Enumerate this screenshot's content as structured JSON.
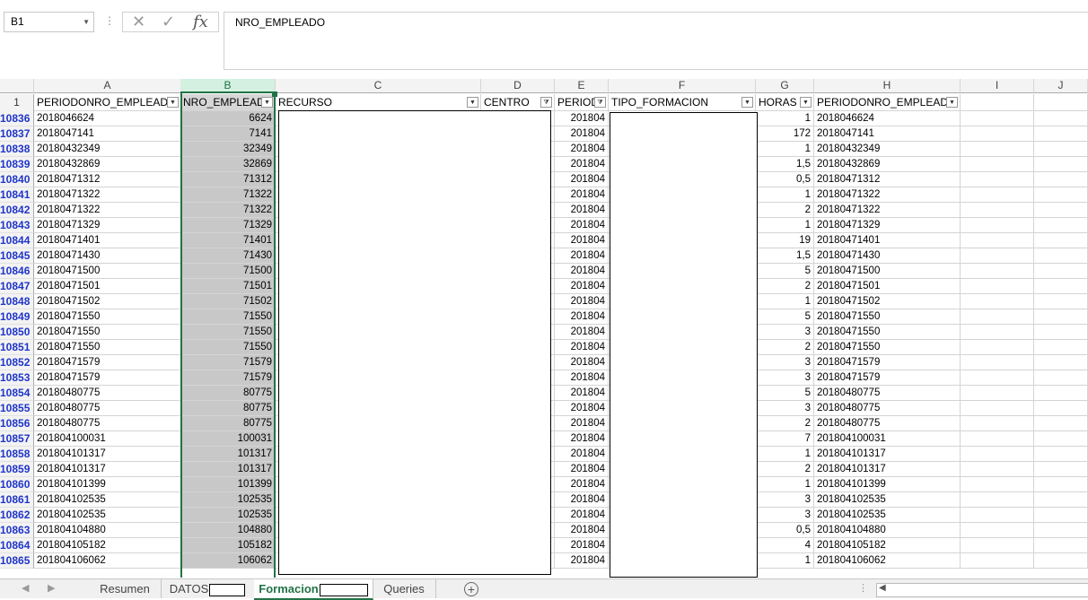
{
  "formula_bar": {
    "name_box": "B1",
    "content": "NRO_EMPLEADO",
    "fx": "fx",
    "cancel": "✕",
    "enter": "✓"
  },
  "columns": [
    "A",
    "B",
    "C",
    "D",
    "E",
    "F",
    "G",
    "H",
    "I",
    "J"
  ],
  "header_row": {
    "number": "1",
    "A": "PERIODONRO_EMPLEADO",
    "B": "NRO_EMPLEADO",
    "C": "RECURSO",
    "D": "CENTRO",
    "E": "PERIOD",
    "F": "TIPO_FORMACION",
    "G": "HORAS",
    "H": "PERIODONRO_EMPLEADO"
  },
  "rows": [
    {
      "n": "10836",
      "a": "2018046624",
      "b": "6624",
      "e": "201804",
      "g": "1",
      "h": "2018046624"
    },
    {
      "n": "10837",
      "a": "2018047141",
      "b": "7141",
      "e": "201804",
      "g": "172",
      "h": "2018047141"
    },
    {
      "n": "10838",
      "a": "20180432349",
      "b": "32349",
      "e": "201804",
      "g": "1",
      "h": "20180432349"
    },
    {
      "n": "10839",
      "a": "20180432869",
      "b": "32869",
      "e": "201804",
      "g": "1,5",
      "h": "20180432869"
    },
    {
      "n": "10840",
      "a": "20180471312",
      "b": "71312",
      "e": "201804",
      "g": "0,5",
      "h": "20180471312"
    },
    {
      "n": "10841",
      "a": "20180471322",
      "b": "71322",
      "e": "201804",
      "g": "1",
      "h": "20180471322"
    },
    {
      "n": "10842",
      "a": "20180471322",
      "b": "71322",
      "e": "201804",
      "g": "2",
      "h": "20180471322"
    },
    {
      "n": "10843",
      "a": "20180471329",
      "b": "71329",
      "e": "201804",
      "g": "1",
      "h": "20180471329"
    },
    {
      "n": "10844",
      "a": "20180471401",
      "b": "71401",
      "e": "201804",
      "g": "19",
      "h": "20180471401"
    },
    {
      "n": "10845",
      "a": "20180471430",
      "b": "71430",
      "e": "201804",
      "g": "1,5",
      "h": "20180471430"
    },
    {
      "n": "10846",
      "a": "20180471500",
      "b": "71500",
      "e": "201804",
      "g": "5",
      "h": "20180471500"
    },
    {
      "n": "10847",
      "a": "20180471501",
      "b": "71501",
      "e": "201804",
      "g": "2",
      "h": "20180471501"
    },
    {
      "n": "10848",
      "a": "20180471502",
      "b": "71502",
      "e": "201804",
      "g": "1",
      "h": "20180471502"
    },
    {
      "n": "10849",
      "a": "20180471550",
      "b": "71550",
      "e": "201804",
      "g": "5",
      "h": "20180471550"
    },
    {
      "n": "10850",
      "a": "20180471550",
      "b": "71550",
      "e": "201804",
      "g": "3",
      "h": "20180471550"
    },
    {
      "n": "10851",
      "a": "20180471550",
      "b": "71550",
      "e": "201804",
      "g": "2",
      "h": "20180471550"
    },
    {
      "n": "10852",
      "a": "20180471579",
      "b": "71579",
      "e": "201804",
      "g": "3",
      "h": "20180471579"
    },
    {
      "n": "10853",
      "a": "20180471579",
      "b": "71579",
      "e": "201804",
      "g": "3",
      "h": "20180471579"
    },
    {
      "n": "10854",
      "a": "20180480775",
      "b": "80775",
      "e": "201804",
      "g": "5",
      "h": "20180480775"
    },
    {
      "n": "10855",
      "a": "20180480775",
      "b": "80775",
      "e": "201804",
      "g": "3",
      "h": "20180480775"
    },
    {
      "n": "10856",
      "a": "20180480775",
      "b": "80775",
      "e": "201804",
      "g": "2",
      "h": "20180480775"
    },
    {
      "n": "10857",
      "a": "201804100031",
      "b": "100031",
      "e": "201804",
      "g": "7",
      "h": "201804100031"
    },
    {
      "n": "10858",
      "a": "201804101317",
      "b": "101317",
      "e": "201804",
      "g": "1",
      "h": "201804101317"
    },
    {
      "n": "10859",
      "a": "201804101317",
      "b": "101317",
      "e": "201804",
      "g": "2",
      "h": "201804101317"
    },
    {
      "n": "10860",
      "a": "201804101399",
      "b": "101399",
      "e": "201804",
      "g": "1",
      "h": "201804101399"
    },
    {
      "n": "10861",
      "a": "201804102535",
      "b": "102535",
      "e": "201804",
      "g": "3",
      "h": "201804102535"
    },
    {
      "n": "10862",
      "a": "201804102535",
      "b": "102535",
      "e": "201804",
      "g": "3",
      "h": "201804102535"
    },
    {
      "n": "10863",
      "a": "201804104880",
      "b": "104880",
      "e": "201804",
      "g": "0,5",
      "h": "201804104880"
    },
    {
      "n": "10864",
      "a": "201804105182",
      "b": "105182",
      "e": "201804",
      "g": "4",
      "h": "201804105182"
    },
    {
      "n": "10865",
      "a": "201804106062",
      "b": "106062",
      "e": "201804",
      "g": "1",
      "h": "201804106062"
    }
  ],
  "tabs": [
    "Resumen",
    "DATOS",
    "Formacion",
    "Queries"
  ],
  "active_tab": "Formacion",
  "colors": {
    "accent": "#217346",
    "row_number": "#1f35c8",
    "selected_column": "#c8c8c8"
  }
}
